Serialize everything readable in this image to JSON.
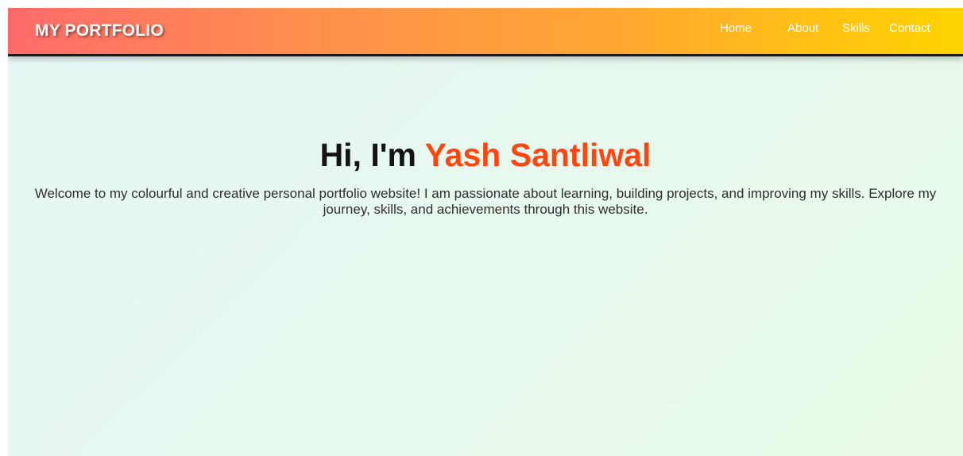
{
  "navbar": {
    "logo": "MY PORTFOLIO",
    "links": [
      {
        "label": "Home"
      },
      {
        "label": "About"
      },
      {
        "label": "Skills"
      },
      {
        "label": "Contact"
      }
    ]
  },
  "hero": {
    "greeting": "Hi, I'm ",
    "name": "Yash Santliwal",
    "description": "Welcome to my colourful and creative personal portfolio website! I am passionate about learning, building projects, and improving my skills. Explore my journey, skills, and achievements through this website."
  },
  "colors": {
    "accent": "#ff4510",
    "nav_gradient_start": "#ff6b6b",
    "nav_gradient_end": "#ffd400",
    "background": "#e7f7f0"
  }
}
